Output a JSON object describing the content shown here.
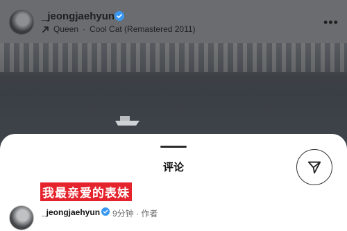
{
  "post": {
    "username": "_jeongjaehyun",
    "music_artist": "Queen",
    "music_separator": "·",
    "music_title": "Cool Cat (Remastered 2011)",
    "more_icon": "more-horizontal-icon"
  },
  "comments_sheet": {
    "title": "评论",
    "highlighted_text": "我最亲爱的表妹",
    "share_icon": "send-icon",
    "comment": {
      "username": "_jeongjaehyun",
      "time": "9分钟",
      "separator": "·",
      "role": "作者"
    }
  },
  "colors": {
    "verified": "#3897f0",
    "highlight": "#e5232c"
  }
}
